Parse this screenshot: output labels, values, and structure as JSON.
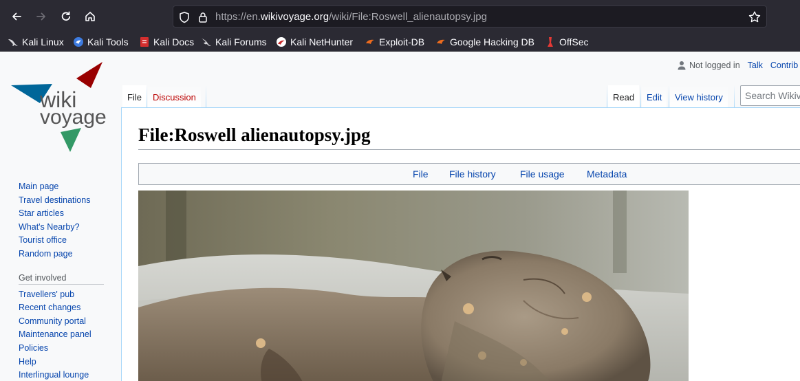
{
  "browser": {
    "url_prefix": "https://en.",
    "url_host": "wikivoyage.org",
    "url_path": "/wiki/File:Roswell_alienautopsy.jpg",
    "bookmarks": [
      "Kali Linux",
      "Kali Tools",
      "Kali Docs",
      "Kali Forums",
      "Kali NetHunter",
      "Exploit-DB",
      "Google Hacking DB",
      "OffSec"
    ]
  },
  "personal": {
    "status": "Not logged in",
    "talk": "Talk",
    "contributions": "Contrib"
  },
  "tabs": {
    "file": "File",
    "discussion": "Discussion",
    "read": "Read",
    "edit": "Edit",
    "history": "View history"
  },
  "search": {
    "placeholder": "Search Wikivoyage"
  },
  "sidebar": {
    "nav": [
      "Main page",
      "Travel destinations",
      "Star articles",
      "What's Nearby?",
      "Tourist office",
      "Random page"
    ],
    "involved_heading": "Get involved",
    "involved": [
      "Travellers' pub",
      "Recent changes",
      "Community portal",
      "Maintenance panel",
      "Policies",
      "Help",
      "Interlingual lounge"
    ]
  },
  "page": {
    "title": "File:Roswell alienautopsy.jpg",
    "filetoc": [
      "File",
      "File history",
      "File usage",
      "Metadata"
    ]
  },
  "logo": {
    "line1": "wiki",
    "line2": "voyage"
  },
  "colors": {
    "link": "#0645ad",
    "new_link": "#ba0000",
    "logo_red": "#990000",
    "logo_blue": "#006699",
    "logo_green": "#339966"
  }
}
